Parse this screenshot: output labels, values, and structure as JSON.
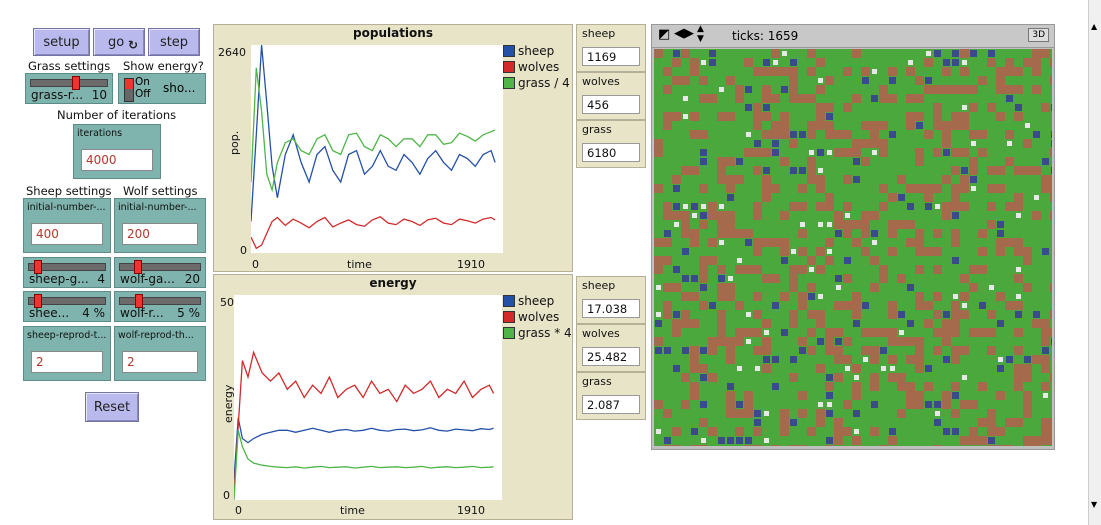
{
  "controls": {
    "setup_label": "setup",
    "go_label": "go",
    "step_label": "step",
    "reset_label": "Reset"
  },
  "labels": {
    "grass_settings": "Grass settings",
    "show_energy": "Show energy?",
    "number_of_iterations": "Number of iterations",
    "sheep_settings": "Sheep settings",
    "wolf_settings": "Wolf settings"
  },
  "sliders": {
    "grass_regrowth": {
      "name": "grass-r...",
      "value": "10",
      "fraction": 0.6
    },
    "sheep_gain": {
      "name": "sheep-g...",
      "value": "4",
      "fraction": 0.08
    },
    "wolf_gain": {
      "name": "wolf-ga...",
      "value": "20",
      "fraction": 0.2
    },
    "sheep_reproduce": {
      "name": "shee...",
      "value": "4 %",
      "fraction": 0.08
    },
    "wolf_reproduce": {
      "name": "wolf-r...",
      "value": "5 %",
      "fraction": 0.22
    }
  },
  "switch": {
    "on": "On",
    "off": "Off",
    "name": "sho..."
  },
  "inputs": {
    "iterations": {
      "caption": "iterations",
      "value": "4000"
    },
    "initial_sheep": {
      "caption": "initial-number-...",
      "value": "400"
    },
    "initial_wolves": {
      "caption": "initial-number-...",
      "value": "200"
    },
    "sheep_reprod_threshold": {
      "caption": "sheep-reprod-t...",
      "value": "2"
    },
    "wolf_reprod_threshold": {
      "caption": "wolf-reprod-th...",
      "value": "2"
    }
  },
  "monitors": {
    "pop_sheep": {
      "caption": "sheep",
      "value": "1169"
    },
    "pop_wolves": {
      "caption": "wolves",
      "value": "456"
    },
    "pop_grass": {
      "caption": "grass",
      "value": "6180"
    },
    "en_sheep": {
      "caption": "sheep",
      "value": "17.038"
    },
    "en_wolves": {
      "caption": "wolves",
      "value": "25.482"
    },
    "en_grass": {
      "caption": "grass",
      "value": "2.087"
    }
  },
  "world": {
    "ticks_label": "ticks: 1659",
    "three_d": "3D"
  },
  "colors": {
    "sheep": "#2450a8",
    "wolves": "#d22a2a",
    "grass": "#4fb548",
    "patch_green": "#4aa83c",
    "patch_brown": "#a5694b"
  },
  "chart_data": [
    {
      "type": "line",
      "title": "populations",
      "xlabel": "time",
      "ylabel": "pop.",
      "xlim": [
        0,
        1910
      ],
      "ylim": [
        0,
        2640
      ],
      "x_ticks": [
        "0",
        "1910"
      ],
      "y_ticks": [
        "0",
        "2640"
      ],
      "legend": "top-right",
      "series": [
        {
          "name": "sheep",
          "color": "#2450a8",
          "x": [
            0,
            40,
            80,
            120,
            160,
            200,
            260,
            320,
            380,
            440,
            500,
            560,
            620,
            680,
            740,
            800,
            860,
            920,
            980,
            1040,
            1100,
            1160,
            1220,
            1280,
            1340,
            1400,
            1460,
            1520,
            1580,
            1640,
            1700,
            1760,
            1820,
            1850
          ],
          "y": [
            400,
            1500,
            2640,
            1900,
            1100,
            700,
            1250,
            1500,
            1150,
            900,
            1250,
            1350,
            1050,
            900,
            1250,
            1300,
            1000,
            1100,
            1300,
            1100,
            1050,
            1250,
            1150,
            1000,
            1200,
            1300,
            1150,
            1050,
            1250,
            1200,
            1100,
            1250,
            1300,
            1150
          ]
        },
        {
          "name": "wolves",
          "color": "#d22a2a",
          "x": [
            0,
            40,
            80,
            120,
            160,
            200,
            260,
            320,
            380,
            440,
            500,
            560,
            620,
            680,
            740,
            800,
            860,
            920,
            980,
            1040,
            1100,
            1160,
            1220,
            1280,
            1340,
            1400,
            1460,
            1520,
            1580,
            1640,
            1700,
            1760,
            1820,
            1850
          ],
          "y": [
            200,
            60,
            100,
            250,
            400,
            450,
            350,
            430,
            380,
            320,
            400,
            450,
            330,
            380,
            420,
            360,
            340,
            420,
            460,
            380,
            360,
            430,
            400,
            350,
            420,
            440,
            380,
            360,
            430,
            410,
            380,
            430,
            450,
            420
          ]
        },
        {
          "name": "grass / 4",
          "color": "#4fb548",
          "x": [
            0,
            40,
            80,
            120,
            160,
            200,
            260,
            320,
            380,
            440,
            500,
            560,
            620,
            680,
            740,
            800,
            860,
            920,
            980,
            1040,
            1100,
            1160,
            1220,
            1280,
            1340,
            1400,
            1460,
            1520,
            1580,
            1640,
            1700,
            1760,
            1820,
            1850
          ],
          "y": [
            900,
            2350,
            1800,
            1000,
            800,
            1150,
            1400,
            1450,
            1300,
            1250,
            1450,
            1500,
            1300,
            1250,
            1500,
            1520,
            1350,
            1300,
            1500,
            1450,
            1350,
            1450,
            1450,
            1350,
            1500,
            1500,
            1380,
            1400,
            1520,
            1480,
            1420,
            1500,
            1540,
            1560
          ]
        }
      ]
    },
    {
      "type": "line",
      "title": "energy",
      "xlabel": "time",
      "ylabel": "energy",
      "xlim": [
        0,
        1910
      ],
      "ylim": [
        0,
        50
      ],
      "x_ticks": [
        "0",
        "1910"
      ],
      "y_ticks": [
        "0",
        "50"
      ],
      "legend": "top-right",
      "series": [
        {
          "name": "sheep",
          "color": "#2450a8",
          "x": [
            0,
            30,
            60,
            100,
            140,
            200,
            260,
            320,
            380,
            440,
            500,
            560,
            620,
            680,
            740,
            800,
            860,
            920,
            980,
            1040,
            1100,
            1160,
            1220,
            1280,
            1340,
            1400,
            1460,
            1520,
            1580,
            1640,
            1700,
            1760,
            1820,
            1850
          ],
          "y": [
            5,
            20,
            15,
            14,
            15,
            16,
            16.5,
            17,
            17,
            16.5,
            17,
            17.5,
            17,
            16.5,
            17,
            17.2,
            16.8,
            17,
            17.5,
            17,
            16.8,
            17.2,
            17.3,
            16.9,
            17.1,
            17.6,
            17,
            16.8,
            17.3,
            17.1,
            16.9,
            17.4,
            17.2,
            17.5
          ]
        },
        {
          "name": "wolves",
          "color": "#d22a2a",
          "x": [
            0,
            30,
            60,
            100,
            140,
            200,
            260,
            320,
            380,
            440,
            500,
            560,
            620,
            680,
            740,
            800,
            860,
            920,
            980,
            1040,
            1100,
            1160,
            1220,
            1280,
            1340,
            1400,
            1460,
            1520,
            1580,
            1640,
            1700,
            1760,
            1820,
            1850
          ],
          "y": [
            2,
            18,
            34,
            30,
            36,
            31,
            29,
            31,
            27,
            29,
            25,
            28,
            26,
            30,
            25,
            27,
            28,
            25,
            29,
            26,
            27,
            24,
            28,
            26,
            27,
            29,
            25,
            27,
            26,
            29,
            25,
            27,
            28,
            26
          ]
        },
        {
          "name": "grass * 4",
          "color": "#4fb548",
          "x": [
            0,
            30,
            60,
            100,
            140,
            200,
            260,
            320,
            380,
            440,
            500,
            560,
            620,
            680,
            740,
            800,
            860,
            920,
            980,
            1040,
            1100,
            1160,
            1220,
            1280,
            1340,
            1400,
            1460,
            1520,
            1580,
            1640,
            1700,
            1760,
            1820,
            1850
          ],
          "y": [
            0,
            17,
            13,
            10,
            9,
            8.5,
            8.2,
            8,
            7.9,
            8.1,
            7.8,
            8,
            8.2,
            7.9,
            8,
            8.1,
            7.8,
            8,
            8.2,
            7.9,
            8,
            8.1,
            7.9,
            8,
            8.2,
            7.8,
            8,
            8.1,
            7.9,
            8,
            8.2,
            7.9,
            8,
            8.1
          ]
        }
      ]
    }
  ]
}
